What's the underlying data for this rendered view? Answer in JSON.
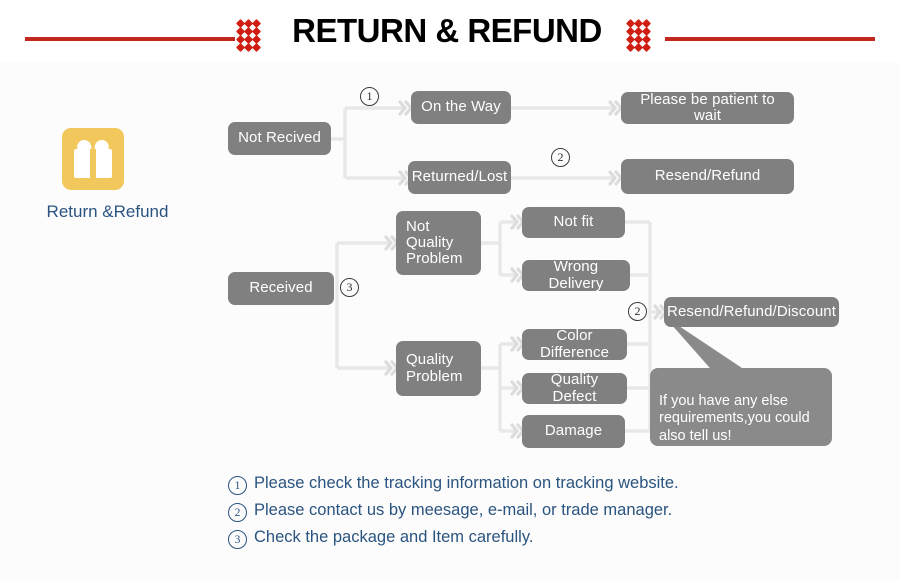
{
  "header": {
    "title": "RETURN & REFUND",
    "rule_color": "#c1271c",
    "dot_color": "#d01d12",
    "left_dots_name": "dot-grid-left",
    "right_dots_name": "dot-grid-right"
  },
  "badge": {
    "icon_name": "gift-icon",
    "label": "Return &Refund",
    "icon_color": "#f2c75c",
    "label_color": "#2a5480"
  },
  "flow": {
    "node_color": "#808080",
    "connector_color": "#e8e8e8",
    "nodes": [
      {
        "id": "not-recived",
        "label": "Not Recived"
      },
      {
        "id": "on-the-way",
        "label": "On the Way"
      },
      {
        "id": "returned-lost",
        "label": "Returned/Lost"
      },
      {
        "id": "please-be-patient",
        "label": "Please be patient to wait"
      },
      {
        "id": "resend-refund",
        "label": "Resend/Refund"
      },
      {
        "id": "received",
        "label": "Received"
      },
      {
        "id": "not-quality-problem",
        "label": "Not\nQuality\nProblem"
      },
      {
        "id": "quality-problem",
        "label": "Quality\nProblem"
      },
      {
        "id": "not-fit",
        "label": "Not fit"
      },
      {
        "id": "wrong-delivery",
        "label": "Wrong Delivery"
      },
      {
        "id": "color-difference",
        "label": "Color Difference"
      },
      {
        "id": "quality-defect",
        "label": "Quality Defect"
      },
      {
        "id": "damage",
        "label": "Damage"
      },
      {
        "id": "resend-refund-discount",
        "label": "Resend/Refund/Discount"
      }
    ],
    "markers": [
      {
        "id": "marker-1",
        "label": "1"
      },
      {
        "id": "marker-2-top",
        "label": "2"
      },
      {
        "id": "marker-3",
        "label": "3"
      },
      {
        "id": "marker-2-bottom",
        "label": "2"
      }
    ],
    "bubble": {
      "text": "If you have any else\nrequirements,you could\nalso tell us!"
    }
  },
  "notes": [
    {
      "num": "1",
      "text": "Please check the tracking information on tracking website."
    },
    {
      "num": "2",
      "text": "Please contact us by meesage, e-mail, or trade manager."
    },
    {
      "num": "3",
      "text": "Check the package and Item carefully."
    }
  ]
}
